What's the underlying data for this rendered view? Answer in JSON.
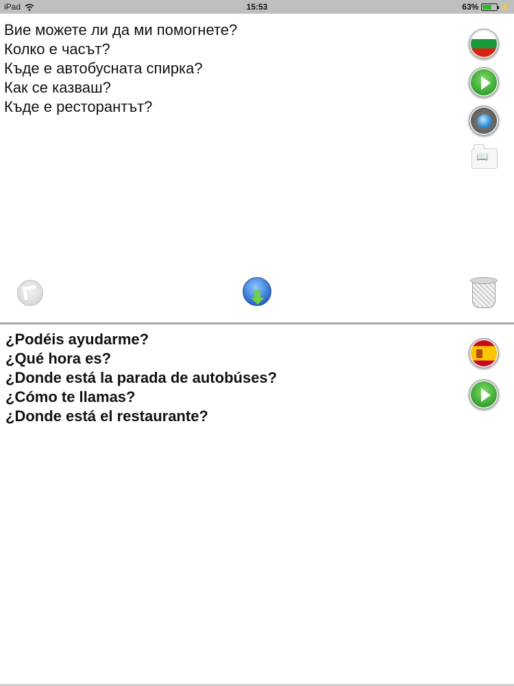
{
  "status_bar": {
    "device": "iPad",
    "time": "15:53",
    "battery_percent_label": "63%",
    "battery_level": 0.63,
    "wifi_icon": "wifi-icon",
    "charging_icon": "charging-bolt-icon"
  },
  "source": {
    "language_flag": "bulgaria-flag-icon",
    "phrases": [
      "Вие можете ли да ми помогнете?",
      "Колко е часът?",
      "Къде е автобусната спирка?",
      "Как се казваш?",
      "Къде е ресторантът?"
    ],
    "icons": [
      "bulgaria-flag-icon",
      "play-icon",
      "record-icon",
      "phrasebook-icon"
    ]
  },
  "toolbar": {
    "icons": [
      "back-arrow-icon",
      "translate-download-icon",
      "trash-icon"
    ]
  },
  "target": {
    "language_flag": "spain-flag-icon",
    "phrases": [
      "¿Podéis ayudarme?",
      "¿Qué hora es?",
      "¿Donde está la parada de autobúses?",
      "¿Cómo te llamas?",
      "¿Donde está el restaurante?"
    ],
    "icons": [
      "spain-flag-icon",
      "play-icon"
    ]
  },
  "colors": {
    "status_bar_bg": "#bfbfbf",
    "divider": "#a9a9a9",
    "play_green": "#2e9d28",
    "battery_green": "#2fb82f"
  }
}
